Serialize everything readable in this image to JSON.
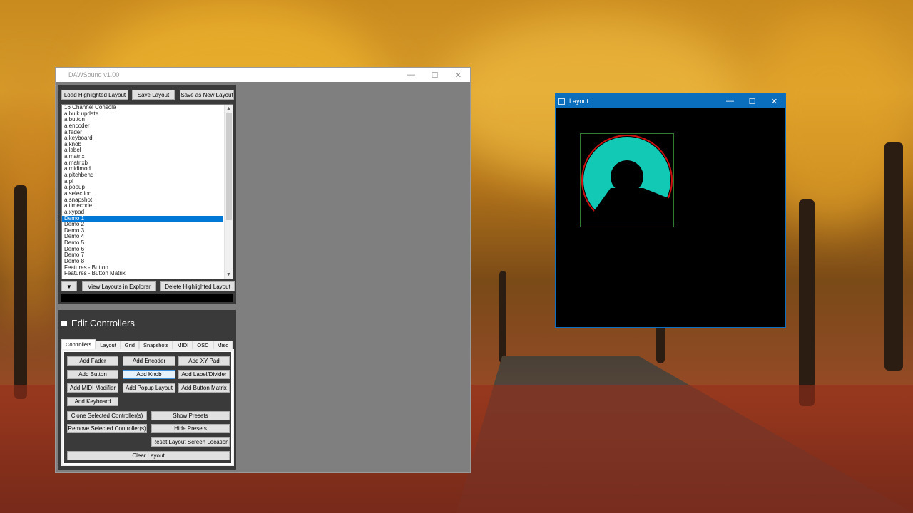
{
  "main_window": {
    "title": "DAWSound  v1.00",
    "caption": {
      "minimize": "—",
      "maximize": "☐",
      "close": "✕"
    }
  },
  "layouts_panel": {
    "load_button": "Load Highlighted Layout",
    "save_button": "Save Layout",
    "save_new_button": "Save as New Layout",
    "items": [
      "16 Channel Console",
      "a bulk update",
      "a button",
      "a encoder",
      "a fader",
      "a keyboard",
      "a knob",
      "a label",
      "a matrix",
      "a matrixb",
      "a midimod",
      "a pitchbend",
      "a pl",
      "a popup",
      "a selection",
      "a snapshot",
      "a timecode",
      "a xypad",
      "Demo 1",
      "Demo 2",
      "Demo 3",
      "Demo 4",
      "Demo 5",
      "Demo 6",
      "Demo 7",
      "Demo 8",
      "Features - Button",
      "Features - Button Matrix"
    ],
    "selected_item": "Demo 1",
    "dropdown_button": "▼",
    "view_explorer_button": "View Layouts in Explorer",
    "delete_button": "Delete Highlighted Layout"
  },
  "edit_controllers": {
    "title": "Edit Controllers",
    "tabs": [
      "Controllers",
      "Layout",
      "Grid",
      "Snapshots",
      "MIDI",
      "OSC",
      "Misc"
    ],
    "active_tab": "Controllers",
    "buttons": {
      "add_fader": "Add Fader",
      "add_encoder": "Add Encoder",
      "add_xy_pad": "Add XY Pad",
      "add_button": "Add Button",
      "add_knob": "Add Knob",
      "add_label_divider": "Add Label/Divider",
      "add_midi_modifier": "Add MIDI Modifier",
      "add_popup_layout": "Add Popup Layout",
      "add_button_matrix": "Add Button Matrix",
      "add_keyboard": "Add Keyboard",
      "clone_selected": "Clone Selected Controller(s)",
      "show_presets": "Show Presets",
      "remove_selected": "Remove Selected Controller(s)",
      "hide_presets": "Hide Presets",
      "reset_location": "Reset Layout Screen Location",
      "clear_layout": "Clear Layout"
    }
  },
  "layout_window": {
    "title": "Layout",
    "caption": {
      "minimize": "—",
      "maximize": "☐",
      "close": "✕"
    },
    "knob": {
      "fill_color": "#12c9b5",
      "ring_color": "#cc1010",
      "outline_color": "#2f7a2f"
    }
  }
}
